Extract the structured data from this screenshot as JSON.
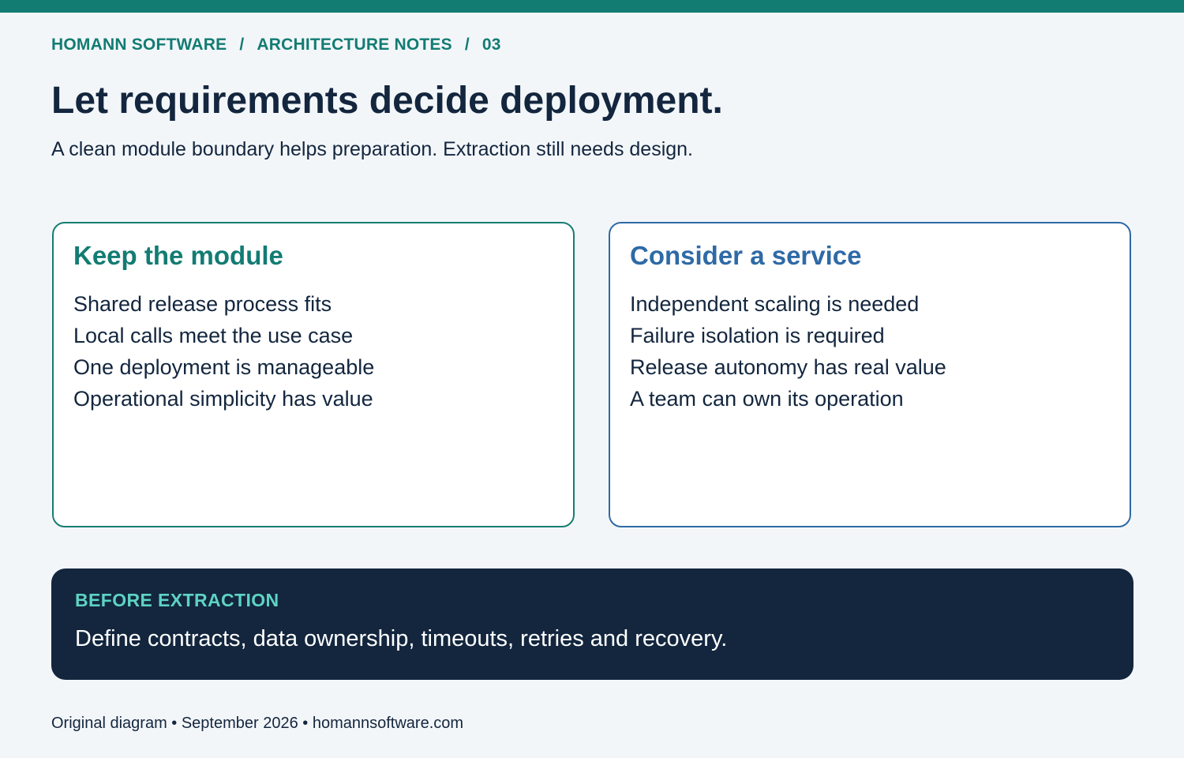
{
  "breadcrumb": {
    "company": "HOMANN SOFTWARE",
    "section": "ARCHITECTURE NOTES",
    "number": "03",
    "separator": "/"
  },
  "title": "Let requirements decide deployment.",
  "subtitle": "A clean module boundary helps preparation. Extraction still needs design.",
  "cards": [
    {
      "title": "Keep the module",
      "accent": "#127c73",
      "items": [
        "Shared release process fits",
        "Local calls meet the use case",
        "One deployment is manageable",
        "Operational simplicity has value"
      ]
    },
    {
      "title": "Consider a service",
      "accent": "#2e6aa6",
      "items": [
        "Independent scaling is needed",
        "Failure isolation is required",
        "Release autonomy has real value",
        "A team can own its operation"
      ]
    }
  ],
  "callout": {
    "label": "BEFORE EXTRACTION",
    "text": "Define contracts, data ownership, timeouts, retries and recovery."
  },
  "footer": "Original diagram • September 2026 • homannsoftware.com",
  "colors": {
    "top_bar": "#127c73",
    "background": "#f3f6f9",
    "text_dark": "#13263e",
    "callout_bg": "#13263e",
    "callout_label": "#5ed3c3"
  }
}
